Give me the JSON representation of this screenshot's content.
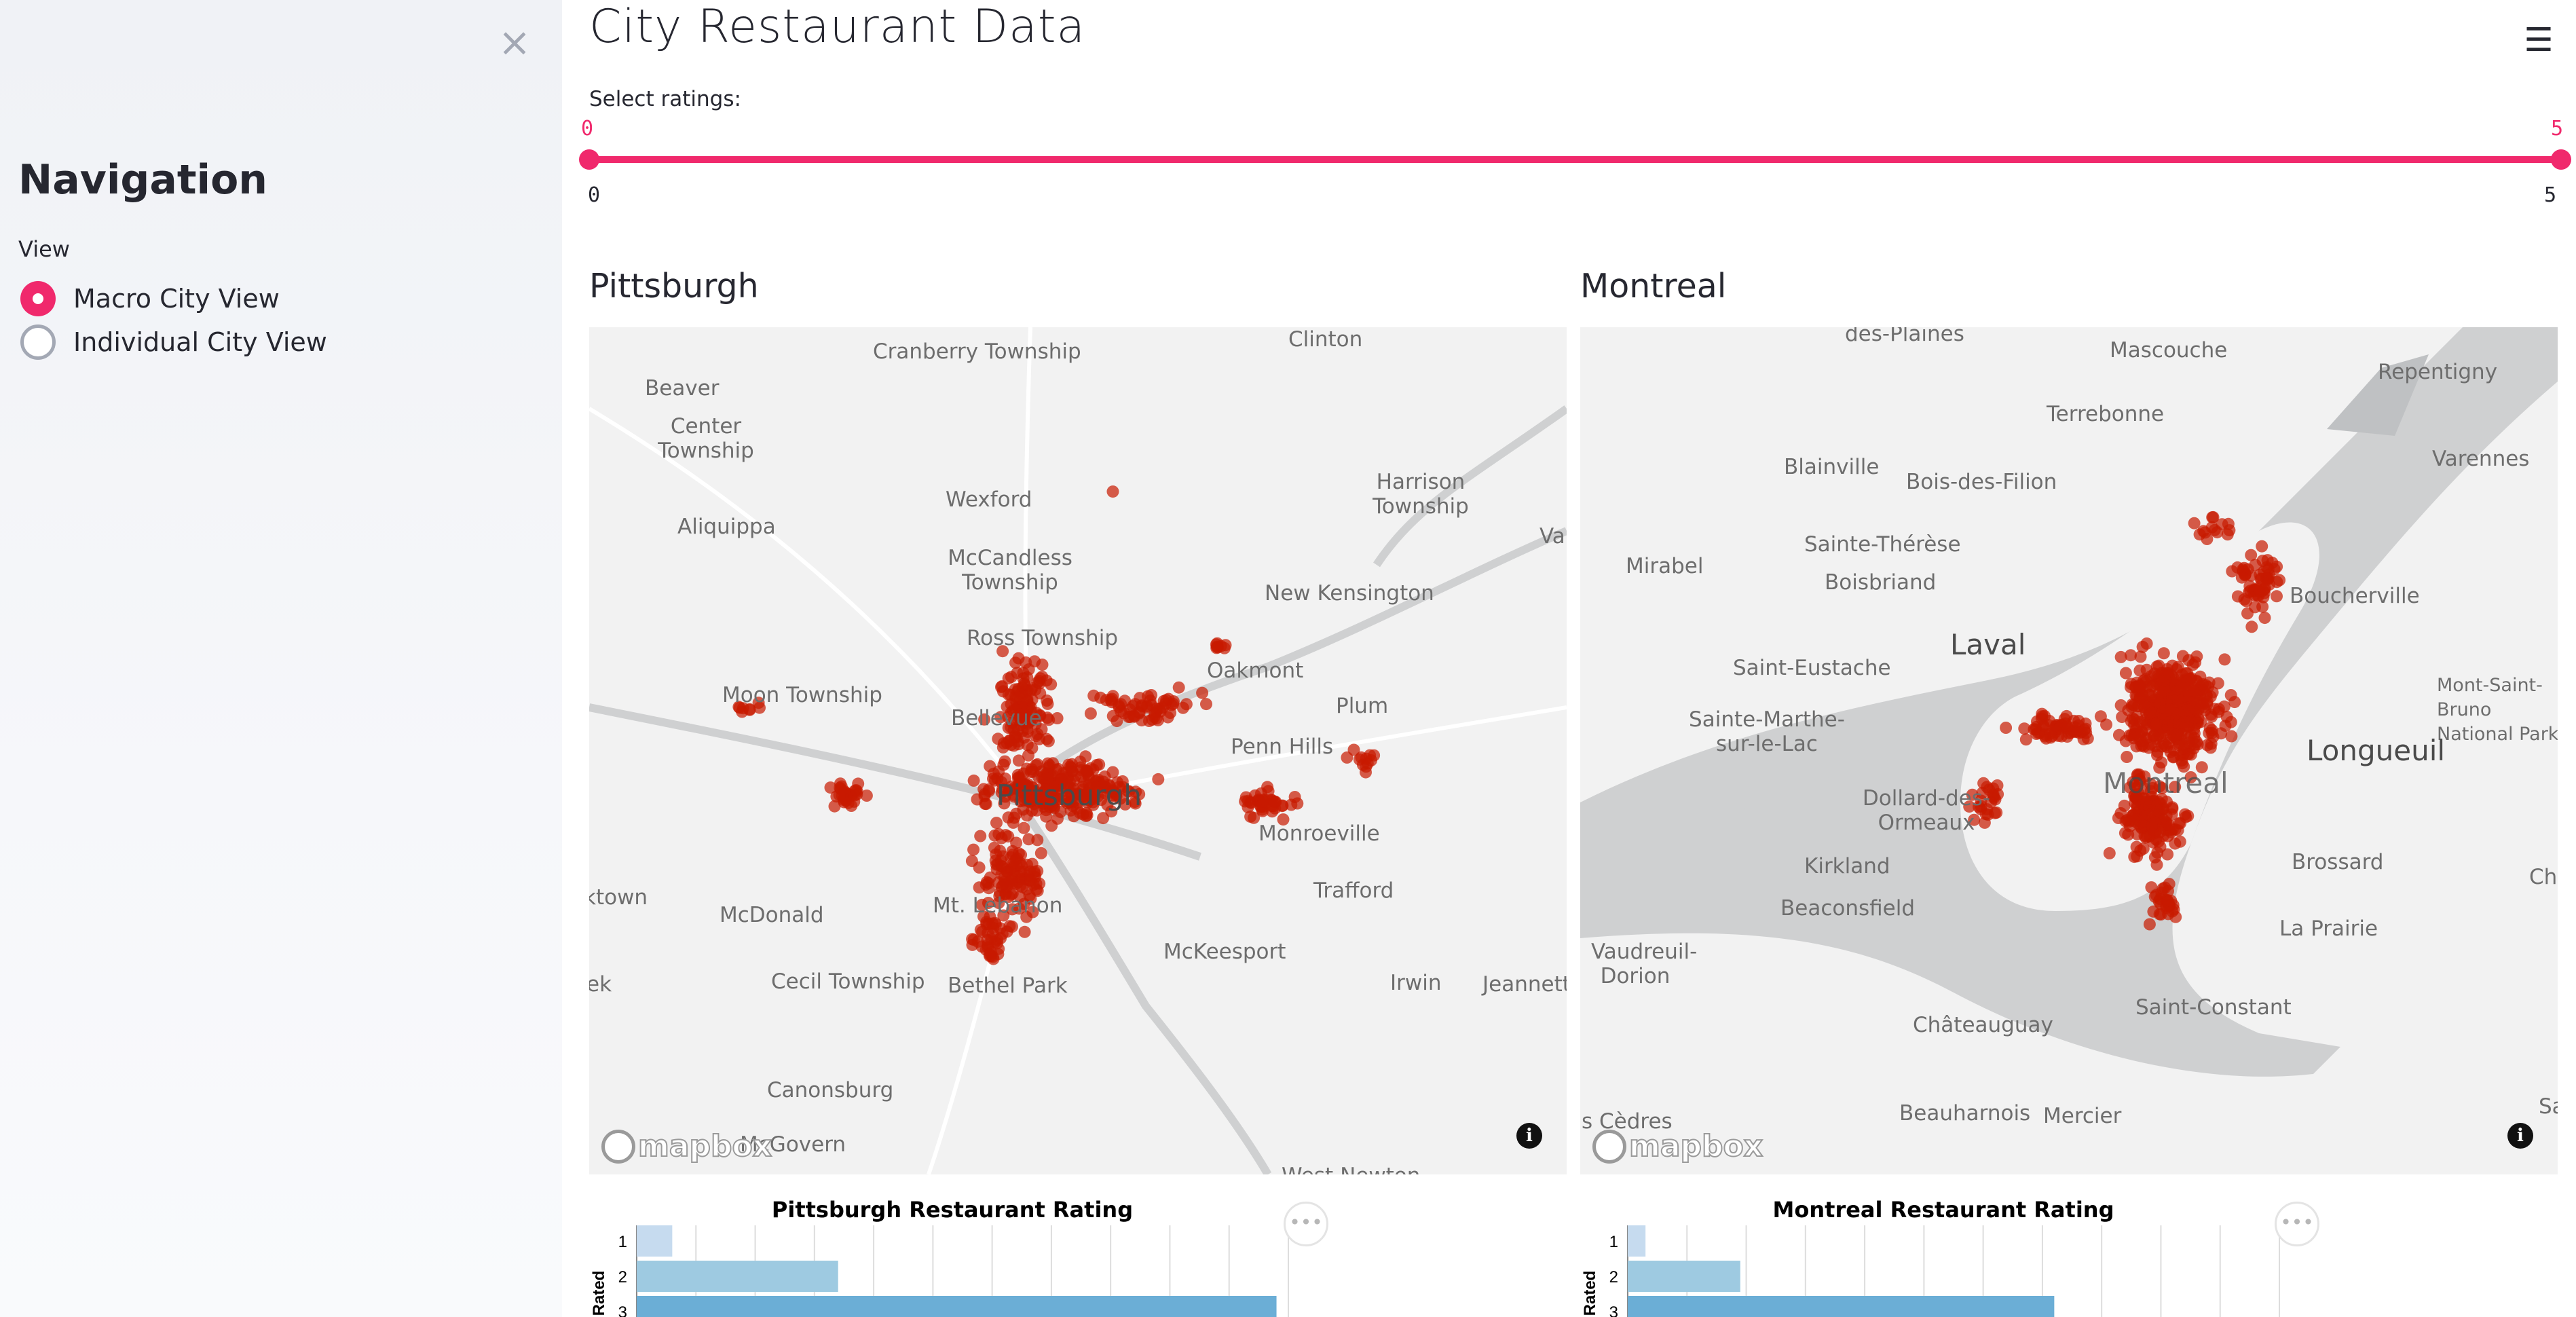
{
  "sidebar": {
    "close_glyph": "×",
    "title": "Navigation",
    "view_label": "View",
    "options": [
      {
        "label": "Macro City View",
        "checked": true
      },
      {
        "label": "Individual City View",
        "checked": false
      }
    ]
  },
  "header": {
    "title": "City Restaurant Data",
    "menu_icon": "☰"
  },
  "slider": {
    "label": "Select ratings:",
    "selected_low": "0",
    "selected_high": "5",
    "min_label": "0",
    "max_label": "5",
    "accent_color": "#f0296c"
  },
  "maps": [
    {
      "city": "Pittsburgh",
      "attribution": "mapbox",
      "info_glyph": "i",
      "labels": [
        "Cranberry Township",
        "Clinton",
        "Beaver",
        "Center Township",
        "Wexford",
        "Harrison Township",
        "Aliquippa",
        "McCandless Township",
        "New Kensington",
        "Ross Township",
        "Oakmont",
        "Moon Township",
        "Bellevue",
        "Plum",
        "Penn Hills",
        "Pittsburgh",
        "Monroeville",
        "Trafford",
        "Mt. Lebanon",
        "McDonald",
        "McKeesport",
        "Cecil Township",
        "Bethel Park",
        "Irwin",
        "Jeannett",
        "Canonsburg",
        "McGovern",
        "ktown",
        "ek",
        "Var",
        "West Newton"
      ]
    },
    {
      "city": "Montreal",
      "attribution": "mapbox",
      "info_glyph": "i",
      "labels": [
        "des-Plaines",
        "Mascouche",
        "Repentigny",
        "Terrebonne",
        "Blainville",
        "Bois-des-Filion",
        "Varennes",
        "Sainte-Thérèse",
        "Mirabel",
        "Boisbriand",
        "Boucherville",
        "Laval",
        "Saint-Eustache",
        "Mont-Saint-Bruno National Park",
        "Sainte-Marthe-sur-le-Lac",
        "Longueuil",
        "Dollard-des-Ormeaux",
        "Montreal",
        "Kirkland",
        "Brossard",
        "Beaconsfield",
        "Chan",
        "Vaudreuil-Dorion",
        "La Prairie",
        "Saint-Constant",
        "Châteauguay",
        "Beauharnois",
        "Mercier",
        "s Cèdres",
        "Sa"
      ]
    }
  ],
  "charts_header": [
    {
      "title": "Pittsburgh Restaurant Rating",
      "more_glyph": "•••"
    },
    {
      "title": "Montreal Restaurant Rating",
      "more_glyph": "•••"
    }
  ],
  "chart_data": [
    {
      "type": "bar",
      "orientation": "horizontal",
      "title": "Pittsburgh Restaurant Rating",
      "ylabel": "Rated",
      "categories": [
        "1",
        "2",
        "3"
      ],
      "values": [
        60,
        340,
        1080
      ],
      "xlim": [
        0,
        1100
      ],
      "colors": [
        "#c6dbef",
        "#9ecae1",
        "#6baed6"
      ],
      "grid": true
    },
    {
      "type": "bar",
      "orientation": "horizontal",
      "title": "Montreal Restaurant Rating",
      "ylabel": "Rated",
      "categories": [
        "1",
        "2",
        "3"
      ],
      "values": [
        30,
        190,
        720
      ],
      "xlim": [
        0,
        1100
      ],
      "colors": [
        "#c6dbef",
        "#9ecae1",
        "#6baed6"
      ],
      "grid": true
    }
  ],
  "colors": {
    "point": "#c81900",
    "water": "#cfd0d1",
    "land": "#f2f2f2",
    "road": "#ffffff"
  }
}
